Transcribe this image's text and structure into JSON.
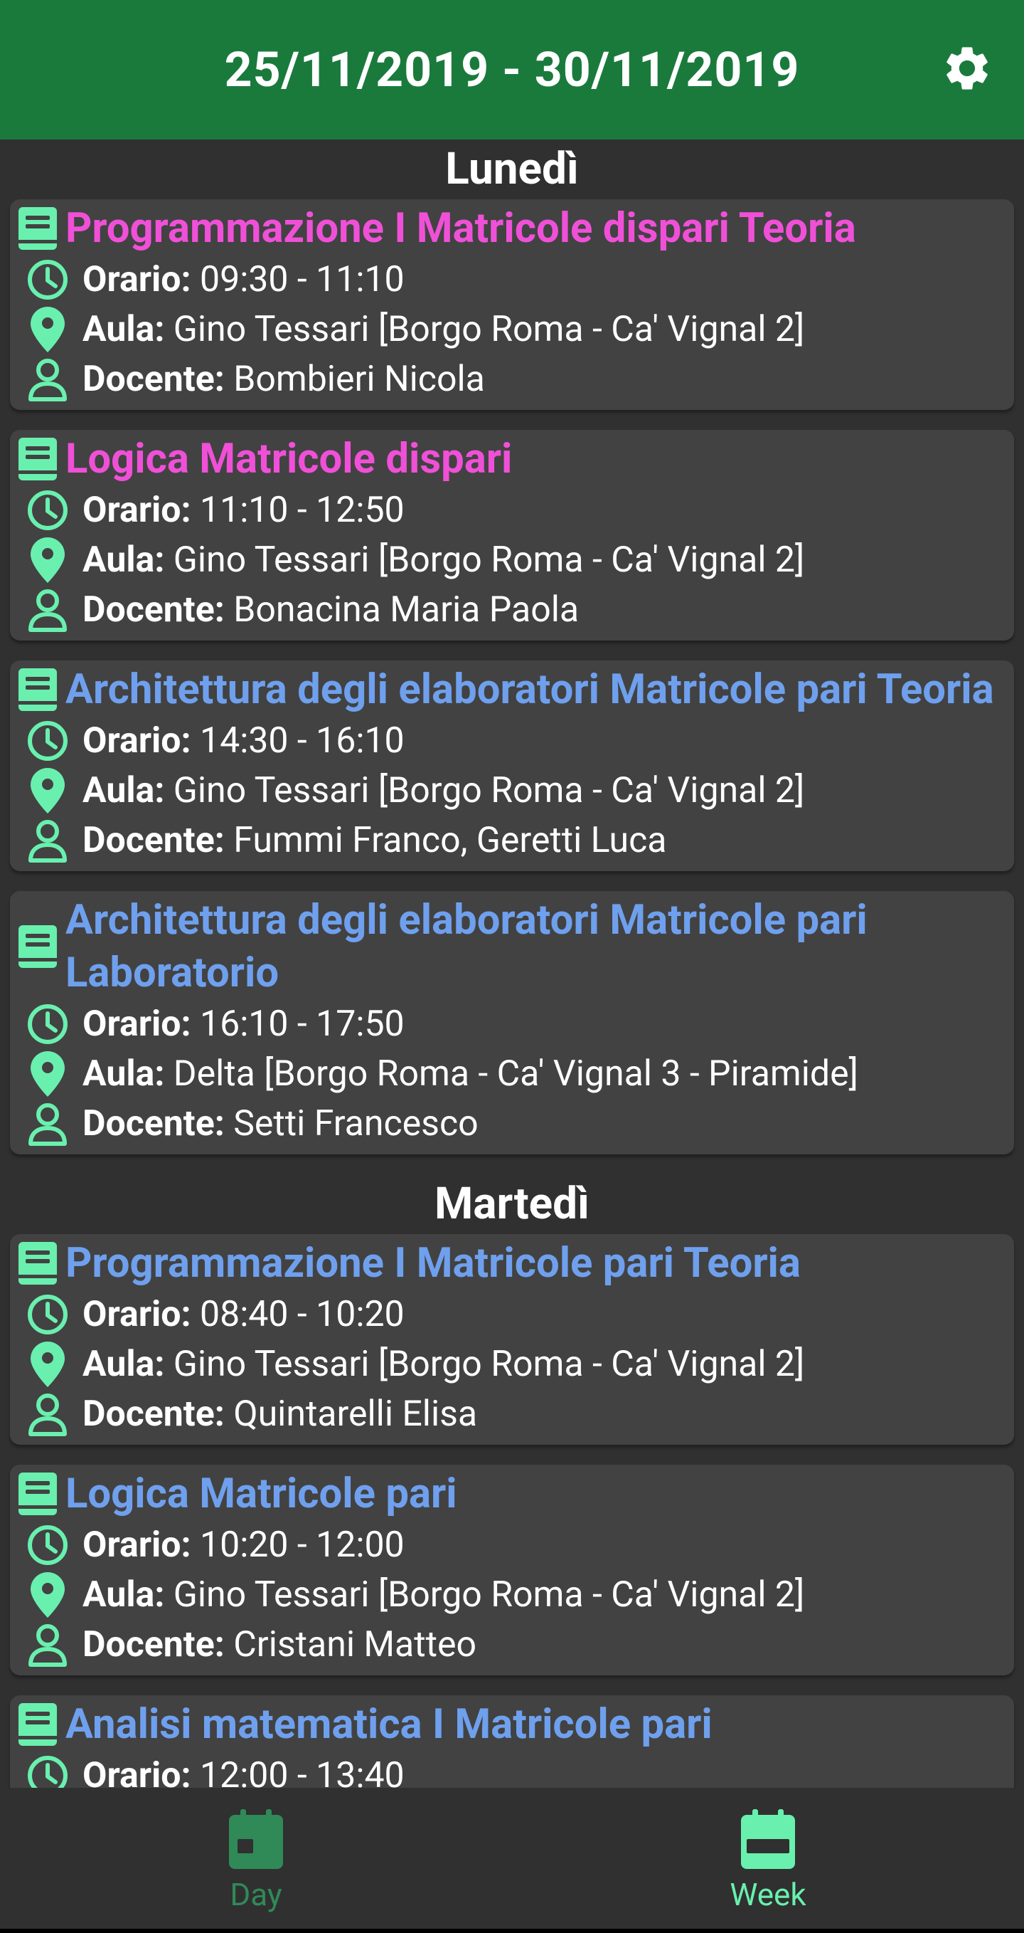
{
  "app_bar": {
    "title": "25/11/2019 - 30/11/2019",
    "settings_icon": "gear-icon",
    "color": "#1a7a3c"
  },
  "colors": {
    "accent": "#69f0ae",
    "course_magenta": "#f050d8",
    "course_blue": "#6fa0ee",
    "card_bg": "#424242",
    "page_bg": "#303030"
  },
  "labels": {
    "orario": "Orario:",
    "aula": "Aula:",
    "docente": "Docente:"
  },
  "days": [
    {
      "name": "Lunedì",
      "lessons": [
        {
          "title": "Programmazione I Matricole dispari Teoria",
          "color": "#f050d8",
          "time": "09:30 - 11:10",
          "room": "Gino Tessari [Borgo Roma - Ca' Vignal 2]",
          "teacher": "Bombieri Nicola"
        },
        {
          "title": "Logica Matricole dispari",
          "color": "#f050d8",
          "time": "11:10 - 12:50",
          "room": "Gino Tessari [Borgo Roma - Ca' Vignal 2]",
          "teacher": "Bonacina Maria Paola"
        },
        {
          "title": "Architettura degli elaboratori Matricole pari Teoria",
          "color": "#6fa0ee",
          "time": "14:30 - 16:10",
          "room": "Gino Tessari [Borgo Roma - Ca' Vignal 2]",
          "teacher": "Fummi Franco, Geretti Luca"
        },
        {
          "title": "Architettura degli elaboratori Matricole pari Laboratorio",
          "color": "#6fa0ee",
          "time": "16:10 - 17:50",
          "room": "Delta [Borgo Roma - Ca' Vignal 3 - Piramide]",
          "teacher": "Setti Francesco"
        }
      ]
    },
    {
      "name": "Martedì",
      "lessons": [
        {
          "title": "Programmazione I Matricole pari Teoria",
          "color": "#6fa0ee",
          "time": "08:40 - 10:20",
          "room": "Gino Tessari [Borgo Roma - Ca' Vignal 2]",
          "teacher": "Quintarelli Elisa"
        },
        {
          "title": "Logica Matricole pari",
          "color": "#6fa0ee",
          "time": "10:20 - 12:00",
          "room": "Gino Tessari [Borgo Roma - Ca' Vignal 2]",
          "teacher": "Cristani Matteo"
        },
        {
          "title": "Analisi matematica I Matricole pari",
          "color": "#6fa0ee",
          "time": "12:00 - 13:40",
          "room": "",
          "teacher": ""
        }
      ]
    }
  ],
  "bottom_nav": {
    "items": [
      {
        "label": "Day",
        "icon": "calendar-day-icon",
        "selected": false
      },
      {
        "label": "Week",
        "icon": "calendar-week-icon",
        "selected": true
      }
    ]
  }
}
